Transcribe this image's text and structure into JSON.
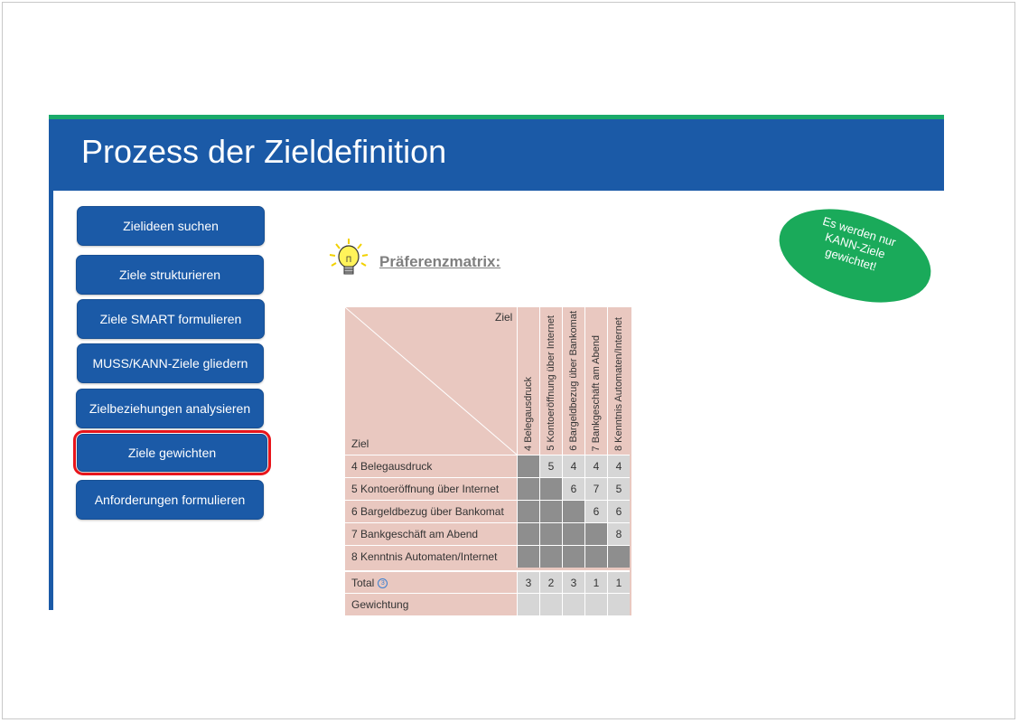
{
  "slide": {
    "title": "Prozess der Zieldefinition"
  },
  "nav": {
    "items": [
      {
        "label": "Zielideen suchen"
      },
      {
        "label": "Ziele strukturieren"
      },
      {
        "label": "Ziele SMART formulieren"
      },
      {
        "label": "MUSS/KANN-Ziele gliedern"
      },
      {
        "label": "Zielbeziehungen analysieren"
      },
      {
        "label": "Ziele gewichten",
        "highlighted": true
      },
      {
        "label": "Anforderungen formulieren"
      }
    ]
  },
  "section": {
    "heading": "Präferenzmatrix:",
    "icon": "lightbulb-icon"
  },
  "callout": {
    "text": "Es werden nur KANN-Ziele gewichtet!"
  },
  "matrix": {
    "corner_top": "Ziel",
    "corner_bottom": "Ziel",
    "columns": [
      "4 Belegausdruck",
      "5 Kontoeröffnung über Internet",
      "6 Bargeldbezug über Bankomat",
      "7 Bankgeschäft am Abend",
      "8 Kenntnis Automaten/Internet"
    ],
    "rows": [
      {
        "label": "4 Belegausdruck",
        "values": [
          "",
          "5",
          "4",
          "4",
          "4"
        ]
      },
      {
        "label": "5 Kontoeröffnung über Internet",
        "values": [
          "",
          "",
          "6",
          "7",
          "5"
        ]
      },
      {
        "label": "6 Bargeldbezug über Bankomat",
        "values": [
          "",
          "",
          "",
          "6",
          "6"
        ]
      },
      {
        "label": "7 Bankgeschäft am Abend",
        "values": [
          "",
          "",
          "",
          "",
          "8"
        ]
      },
      {
        "label": "8 Kenntnis Automaten/Internet",
        "values": [
          "",
          "",
          "",
          "",
          ""
        ]
      }
    ],
    "total_label": "Total",
    "totals": [
      "3",
      "2",
      "3",
      "1",
      "1"
    ],
    "weight_label": "Gewichtung",
    "weights": [
      "",
      "",
      "",
      "",
      ""
    ]
  },
  "colors": {
    "title_bar": "#1b5aa7",
    "accent": "#1aaa6a",
    "highlight_ring": "#e8151b",
    "callout": "#1aaa5a"
  }
}
